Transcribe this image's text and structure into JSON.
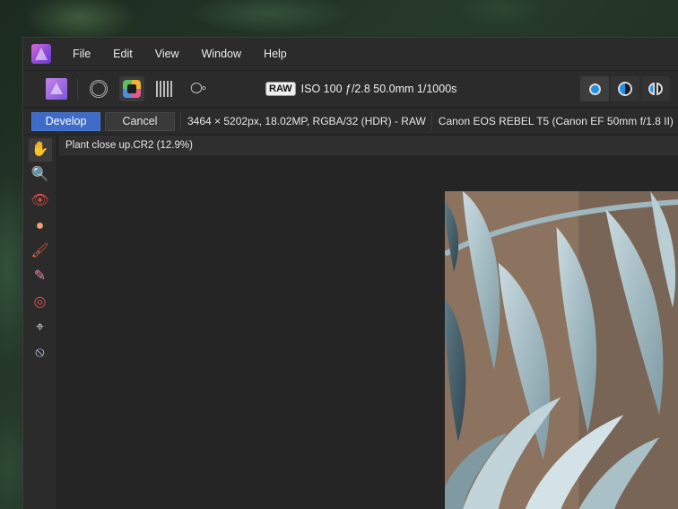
{
  "menu": {
    "items": [
      "File",
      "Edit",
      "View",
      "Window",
      "Help"
    ]
  },
  "toolbar": {
    "personas": [
      {
        "name": "photo-persona-icon"
      },
      {
        "name": "liquify-persona-icon"
      },
      {
        "name": "develop-persona-icon",
        "active": true
      },
      {
        "name": "tone-mapping-persona-icon"
      },
      {
        "name": "export-persona-icon"
      }
    ],
    "raw_badge": "RAW",
    "exif": "ISO 100 ƒ/2.8 50.0mm 1/1000s",
    "view_modes": [
      "single-view-icon",
      "split-view-icon",
      "mirror-view-icon"
    ],
    "accent_color": "#1f8ee8"
  },
  "context": {
    "develop_label": "Develop",
    "cancel_label": "Cancel",
    "image_info": "3464 × 5202px, 18.02MP, RGBA/32 (HDR) - RAW",
    "camera_info": "Canon EOS REBEL T5 (Canon EF 50mm f/1.8 II)",
    "develop_color": "#3d6bc7"
  },
  "tools": [
    {
      "name": "view-tool-icon",
      "glyph": "✋",
      "active": true
    },
    {
      "name": "zoom-tool-icon",
      "glyph": "🔍"
    },
    {
      "name": "red-eye-tool-icon",
      "glyph": "👁"
    },
    {
      "name": "blemish-removal-tool-icon",
      "glyph": "🩹"
    },
    {
      "name": "overlay-paint-tool-icon",
      "glyph": "🖌"
    },
    {
      "name": "overlay-erase-tool-icon",
      "glyph": "✎"
    },
    {
      "name": "overlay-gradient-tool-icon",
      "glyph": "◎"
    },
    {
      "name": "crop-tool-icon",
      "glyph": "⌗"
    },
    {
      "name": "white-balance-tool-icon",
      "glyph": "⦸"
    }
  ],
  "document": {
    "tab_label": "Plant close up.CR2 (12.9%)"
  }
}
